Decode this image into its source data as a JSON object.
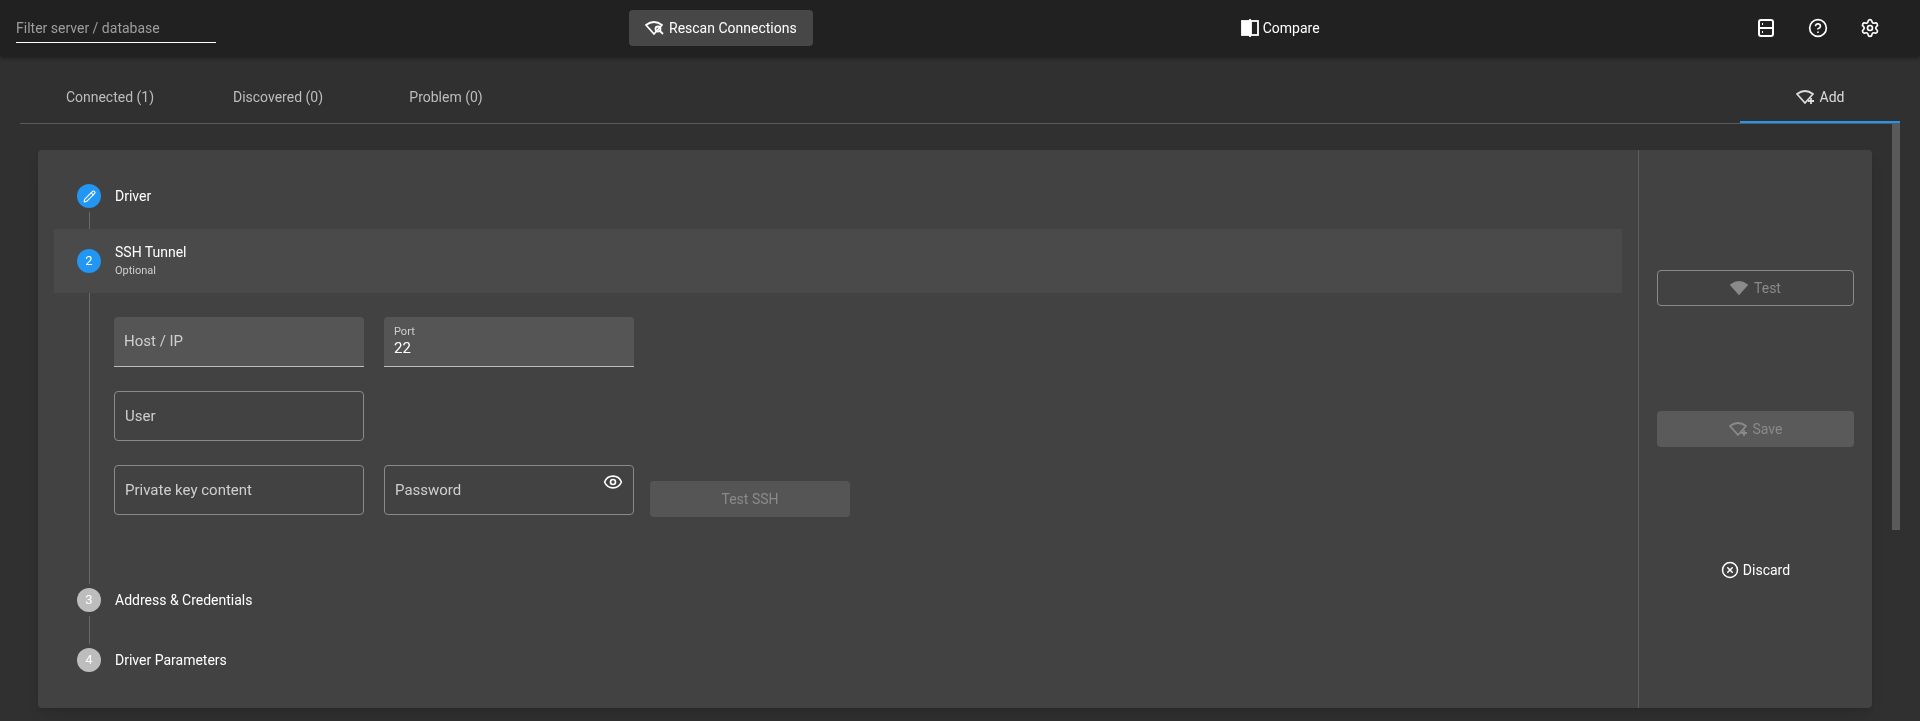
{
  "top_bar": {
    "filter": {
      "placeholder": "Filter server / database"
    },
    "rescan_button": "Rescan Connections",
    "compare_button": "Compare"
  },
  "tabs": [
    {
      "kind": "list",
      "label": "Connected (1)",
      "selected": false
    },
    {
      "kind": "list",
      "label": "Discovered (0)",
      "selected": false
    },
    {
      "kind": "list",
      "label": "Problem (0)",
      "selected": false
    },
    {
      "kind": "add",
      "label": "Add",
      "selected": true
    }
  ],
  "steps": [
    {
      "editing": true,
      "active": false,
      "title": "Driver"
    },
    {
      "editing": false,
      "active": true,
      "number": "2",
      "title": "SSH Tunnel",
      "subtitle": "Optional"
    },
    {
      "editing": false,
      "active": false,
      "number": "3",
      "title": "Address & Credentials"
    },
    {
      "editing": false,
      "active": false,
      "number": "4",
      "title": "Driver Parameters"
    }
  ],
  "ssh_form": {
    "rows": [
      [
        {
          "kind": "filled",
          "label": "Host / IP"
        },
        {
          "kind": "filled",
          "label": "Port",
          "value": "22"
        }
      ],
      [
        {
          "kind": "outlined",
          "label": "User"
        }
      ],
      [
        {
          "kind": "outlined",
          "label": "Private key content"
        },
        {
          "kind": "password",
          "label": "Password"
        }
      ]
    ],
    "test_ssh_button": {
      "label": "Test SSH",
      "disabled": true
    }
  },
  "actions": [
    {
      "kind": "test",
      "label": "Test",
      "disabled": true
    },
    {
      "kind": "save",
      "label": "Save",
      "disabled": true
    },
    {
      "kind": "discard",
      "label": "Discard",
      "disabled": false
    }
  ]
}
